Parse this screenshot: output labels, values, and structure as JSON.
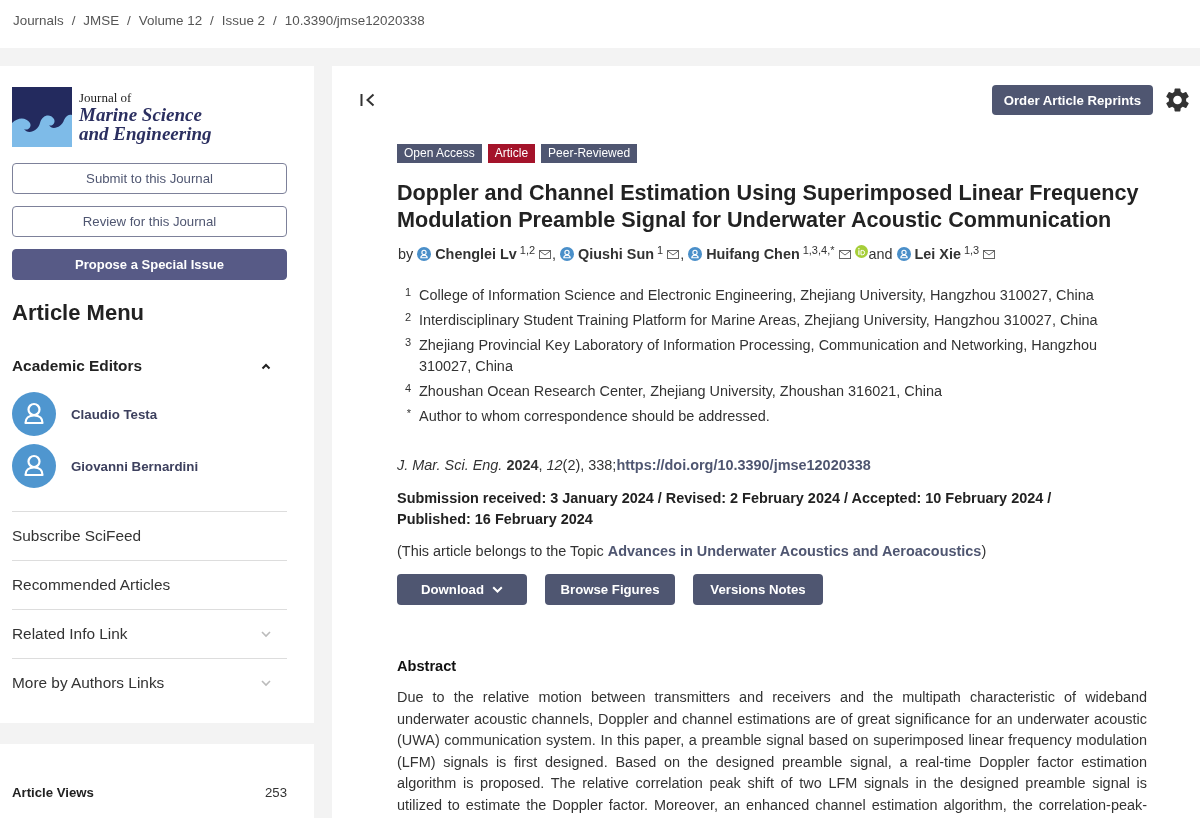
{
  "breadcrumb": {
    "separator": "/",
    "items": [
      "Journals",
      "JMSE",
      "Volume 12",
      "Issue 2",
      "10.3390/jmse12020338"
    ]
  },
  "sidebar": {
    "logo": {
      "prefix": "Journal of",
      "title_lines": [
        "Marine Science",
        "and Engineering"
      ]
    },
    "buttons": [
      {
        "label": "Submit to this Journal",
        "kind": "outline"
      },
      {
        "label": "Review for this Journal",
        "kind": "outline"
      },
      {
        "label": "Propose a Special Issue",
        "kind": "filled"
      }
    ],
    "menu_title": "Article Menu",
    "editors": {
      "title": "Academic Editors",
      "expanded": true,
      "people": [
        {
          "name": "Claudio Testa"
        },
        {
          "name": "Giovanni Bernardini"
        }
      ]
    },
    "menu_items": [
      {
        "label": "Subscribe SciFeed",
        "kind": "link"
      },
      {
        "label": "Recommended Articles",
        "kind": "link"
      },
      {
        "label": "Related Info Link",
        "kind": "collapsible",
        "expanded": false
      },
      {
        "label": "More by Authors Links",
        "kind": "collapsible",
        "expanded": false
      }
    ],
    "stats": [
      {
        "label": "Article Views",
        "value": "253"
      }
    ]
  },
  "article": {
    "reprints_button": "Order Article Reprints",
    "badges": [
      {
        "label": "Open Access",
        "color": "#4f5671"
      },
      {
        "label": "Article",
        "color": "#a4132a"
      },
      {
        "label": "Peer-Reviewed",
        "color": "#4f5671"
      }
    ],
    "title": "Doppler and Channel Estimation Using Superimposed Linear Frequency Modulation Preamble Signal for Underwater Acoustic Communication",
    "authors": [
      {
        "prefix": "by",
        "name": "Chenglei Lv",
        "affiliations": "1,2",
        "email": true,
        "orcid": false
      },
      {
        "prefix": ",",
        "name": "Qiushi Sun",
        "affiliations": "1",
        "email": true,
        "orcid": false
      },
      {
        "prefix": ",",
        "name": "Huifang Chen",
        "affiliations": "1,3,4,*",
        "email": true,
        "orcid": true
      },
      {
        "prefix": "and",
        "name": "Lei Xie",
        "affiliations": "1,3",
        "email": true,
        "orcid": false
      }
    ],
    "affiliations": [
      {
        "mark": "1",
        "text": "College of Information Science and Electronic Engineering, Zhejiang University, Hangzhou 310027, China"
      },
      {
        "mark": "2",
        "text": "Interdisciplinary Student Training Platform for Marine Areas, Zhejiang University, Hangzhou 310027, China"
      },
      {
        "mark": "3",
        "text": "Zhejiang Provincial Key Laboratory of Information Processing, Communication and Networking, Hangzhou 310027, China"
      },
      {
        "mark": "4",
        "text": "Zhoushan Ocean Research Center, Zhejiang University, Zhoushan 316021, China"
      },
      {
        "mark": "*",
        "text": "Author to whom correspondence should be addressed."
      }
    ],
    "citation": "*J. Mar. Sci. Eng.* **2024**, *12*(2), 338;",
    "doi": "https://doi.org/10.3390/jmse12020338",
    "dates": "Submission received: 3 January 2024 / Revised: 2 February 2024 / Accepted: 10 February 2024 / Published: 16 February 2024",
    "topic": {
      "prefix": "(This article belongs to the Topic",
      "link": "Advances in Underwater Acoustics and Aeroacoustics",
      "suffix": ")"
    },
    "actions": [
      {
        "label": "Download",
        "kind": "dropdown"
      },
      {
        "label": "Browse Figures",
        "kind": "button"
      },
      {
        "label": "Versions Notes",
        "kind": "button"
      }
    ],
    "abstract": {
      "heading": "Abstract",
      "text": "Due to the relative motion between transmitters and receivers and the multipath characteristic of wideband underwater acoustic channels, Doppler and channel estimations are of great significance for an underwater acoustic (UWA) communication system. In this paper, a preamble signal based on superimposed linear frequency modulation (LFM) signals is first designed. Based on the designed preamble signal, a real-time Doppler factor estimation algorithm is proposed. The relative correlation peak shift of two LFM signals in the designed preamble signal is utilized to estimate the Doppler factor. Moreover, an enhanced channel estimation algorithm, the correlation-peak-"
    }
  }
}
